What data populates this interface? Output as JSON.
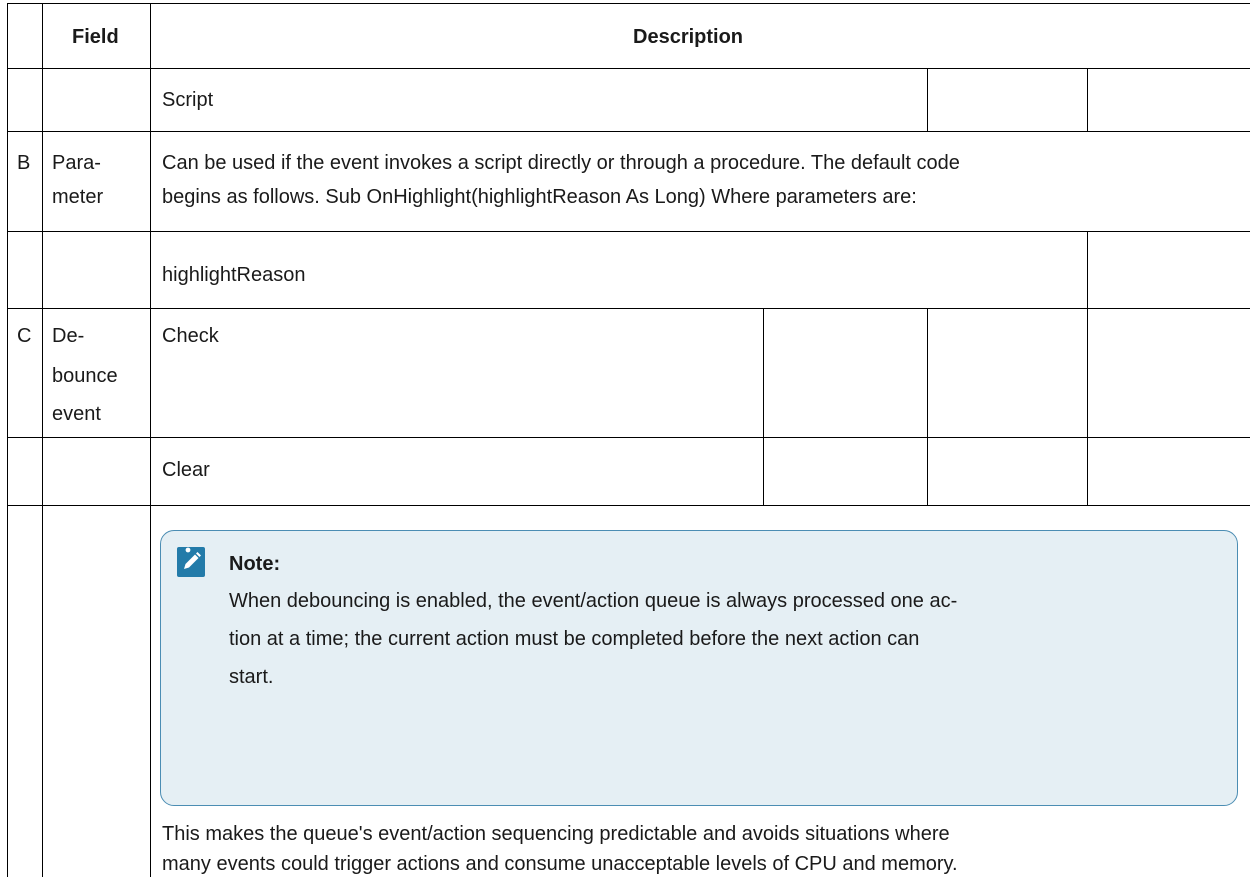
{
  "table": {
    "header": {
      "col_letter": "",
      "field": "Field",
      "description": "Description"
    },
    "rows": [
      {
        "letter": "",
        "field": [],
        "desc": [
          "Script"
        ]
      },
      {
        "letter": "B",
        "field": [
          "Para-",
          "meter"
        ],
        "desc": [
          "Can be used if the event invokes a script directly or through a procedure. The default code",
          "begins as follows. Sub OnHighlight(highlightReason As Long) Where parameters are:"
        ]
      },
      {
        "letter": "",
        "field": [],
        "desc": [
          "highlightReason"
        ]
      },
      {
        "letter": "C",
        "field": [
          "De-",
          "bounce",
          "event"
        ],
        "desc": [
          "Check"
        ]
      },
      {
        "letter": "",
        "field": [],
        "desc": [
          "Clear"
        ]
      }
    ]
  },
  "note": {
    "icon": "pencil-note-icon",
    "title": "Note:",
    "lines": [
      "When debouncing is enabled, the event/action queue is always processed one ac-",
      "tion at a time; the current action must be completed before the next action can",
      "start."
    ]
  },
  "footer_text": [
    "This makes the queue's event/action sequencing predictable and avoids situations where",
    "many events could trigger actions and consume unacceptable levels of CPU and memory."
  ],
  "colors": {
    "border": "#000000",
    "note_bg": "#e5eff4",
    "note_border": "#4b8db3",
    "icon_bg": "#237ba9"
  }
}
